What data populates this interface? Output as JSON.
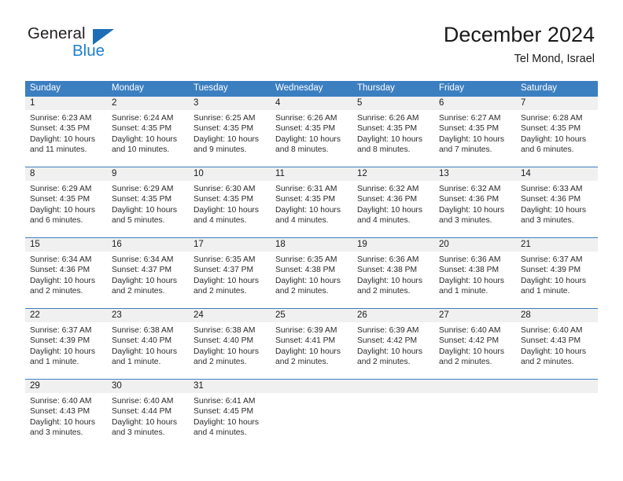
{
  "brand": {
    "name_part1": "General",
    "name_part2": "Blue",
    "triangle_color": "#1f6db4",
    "blue_color": "#1f7fd0"
  },
  "header": {
    "title": "December 2024",
    "subtitle": "Tel Mond, Israel"
  },
  "theme": {
    "header_bg": "#3c7fc1",
    "header_text": "#ffffff",
    "date_band_bg": "#f0f0f0",
    "cell_bg": "#ffffff",
    "divider": "#3c7fc1"
  },
  "weekdays": [
    "Sunday",
    "Monday",
    "Tuesday",
    "Wednesday",
    "Thursday",
    "Friday",
    "Saturday"
  ],
  "weeks": [
    {
      "days": [
        {
          "date": "1",
          "sunrise": "Sunrise: 6:23 AM",
          "sunset": "Sunset: 4:35 PM",
          "daylight_line1": "Daylight: 10 hours",
          "daylight_line2": "and 11 minutes."
        },
        {
          "date": "2",
          "sunrise": "Sunrise: 6:24 AM",
          "sunset": "Sunset: 4:35 PM",
          "daylight_line1": "Daylight: 10 hours",
          "daylight_line2": "and 10 minutes."
        },
        {
          "date": "3",
          "sunrise": "Sunrise: 6:25 AM",
          "sunset": "Sunset: 4:35 PM",
          "daylight_line1": "Daylight: 10 hours",
          "daylight_line2": "and 9 minutes."
        },
        {
          "date": "4",
          "sunrise": "Sunrise: 6:26 AM",
          "sunset": "Sunset: 4:35 PM",
          "daylight_line1": "Daylight: 10 hours",
          "daylight_line2": "and 8 minutes."
        },
        {
          "date": "5",
          "sunrise": "Sunrise: 6:26 AM",
          "sunset": "Sunset: 4:35 PM",
          "daylight_line1": "Daylight: 10 hours",
          "daylight_line2": "and 8 minutes."
        },
        {
          "date": "6",
          "sunrise": "Sunrise: 6:27 AM",
          "sunset": "Sunset: 4:35 PM",
          "daylight_line1": "Daylight: 10 hours",
          "daylight_line2": "and 7 minutes."
        },
        {
          "date": "7",
          "sunrise": "Sunrise: 6:28 AM",
          "sunset": "Sunset: 4:35 PM",
          "daylight_line1": "Daylight: 10 hours",
          "daylight_line2": "and 6 minutes."
        }
      ]
    },
    {
      "days": [
        {
          "date": "8",
          "sunrise": "Sunrise: 6:29 AM",
          "sunset": "Sunset: 4:35 PM",
          "daylight_line1": "Daylight: 10 hours",
          "daylight_line2": "and 6 minutes."
        },
        {
          "date": "9",
          "sunrise": "Sunrise: 6:29 AM",
          "sunset": "Sunset: 4:35 PM",
          "daylight_line1": "Daylight: 10 hours",
          "daylight_line2": "and 5 minutes."
        },
        {
          "date": "10",
          "sunrise": "Sunrise: 6:30 AM",
          "sunset": "Sunset: 4:35 PM",
          "daylight_line1": "Daylight: 10 hours",
          "daylight_line2": "and 4 minutes."
        },
        {
          "date": "11",
          "sunrise": "Sunrise: 6:31 AM",
          "sunset": "Sunset: 4:35 PM",
          "daylight_line1": "Daylight: 10 hours",
          "daylight_line2": "and 4 minutes."
        },
        {
          "date": "12",
          "sunrise": "Sunrise: 6:32 AM",
          "sunset": "Sunset: 4:36 PM",
          "daylight_line1": "Daylight: 10 hours",
          "daylight_line2": "and 4 minutes."
        },
        {
          "date": "13",
          "sunrise": "Sunrise: 6:32 AM",
          "sunset": "Sunset: 4:36 PM",
          "daylight_line1": "Daylight: 10 hours",
          "daylight_line2": "and 3 minutes."
        },
        {
          "date": "14",
          "sunrise": "Sunrise: 6:33 AM",
          "sunset": "Sunset: 4:36 PM",
          "daylight_line1": "Daylight: 10 hours",
          "daylight_line2": "and 3 minutes."
        }
      ]
    },
    {
      "days": [
        {
          "date": "15",
          "sunrise": "Sunrise: 6:34 AM",
          "sunset": "Sunset: 4:36 PM",
          "daylight_line1": "Daylight: 10 hours",
          "daylight_line2": "and 2 minutes."
        },
        {
          "date": "16",
          "sunrise": "Sunrise: 6:34 AM",
          "sunset": "Sunset: 4:37 PM",
          "daylight_line1": "Daylight: 10 hours",
          "daylight_line2": "and 2 minutes."
        },
        {
          "date": "17",
          "sunrise": "Sunrise: 6:35 AM",
          "sunset": "Sunset: 4:37 PM",
          "daylight_line1": "Daylight: 10 hours",
          "daylight_line2": "and 2 minutes."
        },
        {
          "date": "18",
          "sunrise": "Sunrise: 6:35 AM",
          "sunset": "Sunset: 4:38 PM",
          "daylight_line1": "Daylight: 10 hours",
          "daylight_line2": "and 2 minutes."
        },
        {
          "date": "19",
          "sunrise": "Sunrise: 6:36 AM",
          "sunset": "Sunset: 4:38 PM",
          "daylight_line1": "Daylight: 10 hours",
          "daylight_line2": "and 2 minutes."
        },
        {
          "date": "20",
          "sunrise": "Sunrise: 6:36 AM",
          "sunset": "Sunset: 4:38 PM",
          "daylight_line1": "Daylight: 10 hours",
          "daylight_line2": "and 1 minute."
        },
        {
          "date": "21",
          "sunrise": "Sunrise: 6:37 AM",
          "sunset": "Sunset: 4:39 PM",
          "daylight_line1": "Daylight: 10 hours",
          "daylight_line2": "and 1 minute."
        }
      ]
    },
    {
      "days": [
        {
          "date": "22",
          "sunrise": "Sunrise: 6:37 AM",
          "sunset": "Sunset: 4:39 PM",
          "daylight_line1": "Daylight: 10 hours",
          "daylight_line2": "and 1 minute."
        },
        {
          "date": "23",
          "sunrise": "Sunrise: 6:38 AM",
          "sunset": "Sunset: 4:40 PM",
          "daylight_line1": "Daylight: 10 hours",
          "daylight_line2": "and 1 minute."
        },
        {
          "date": "24",
          "sunrise": "Sunrise: 6:38 AM",
          "sunset": "Sunset: 4:40 PM",
          "daylight_line1": "Daylight: 10 hours",
          "daylight_line2": "and 2 minutes."
        },
        {
          "date": "25",
          "sunrise": "Sunrise: 6:39 AM",
          "sunset": "Sunset: 4:41 PM",
          "daylight_line1": "Daylight: 10 hours",
          "daylight_line2": "and 2 minutes."
        },
        {
          "date": "26",
          "sunrise": "Sunrise: 6:39 AM",
          "sunset": "Sunset: 4:42 PM",
          "daylight_line1": "Daylight: 10 hours",
          "daylight_line2": "and 2 minutes."
        },
        {
          "date": "27",
          "sunrise": "Sunrise: 6:40 AM",
          "sunset": "Sunset: 4:42 PM",
          "daylight_line1": "Daylight: 10 hours",
          "daylight_line2": "and 2 minutes."
        },
        {
          "date": "28",
          "sunrise": "Sunrise: 6:40 AM",
          "sunset": "Sunset: 4:43 PM",
          "daylight_line1": "Daylight: 10 hours",
          "daylight_line2": "and 2 minutes."
        }
      ]
    },
    {
      "days": [
        {
          "date": "29",
          "sunrise": "Sunrise: 6:40 AM",
          "sunset": "Sunset: 4:43 PM",
          "daylight_line1": "Daylight: 10 hours",
          "daylight_line2": "and 3 minutes."
        },
        {
          "date": "30",
          "sunrise": "Sunrise: 6:40 AM",
          "sunset": "Sunset: 4:44 PM",
          "daylight_line1": "Daylight: 10 hours",
          "daylight_line2": "and 3 minutes."
        },
        {
          "date": "31",
          "sunrise": "Sunrise: 6:41 AM",
          "sunset": "Sunset: 4:45 PM",
          "daylight_line1": "Daylight: 10 hours",
          "daylight_line2": "and 4 minutes."
        },
        {
          "date": "",
          "sunrise": "",
          "sunset": "",
          "daylight_line1": "",
          "daylight_line2": ""
        },
        {
          "date": "",
          "sunrise": "",
          "sunset": "",
          "daylight_line1": "",
          "daylight_line2": ""
        },
        {
          "date": "",
          "sunrise": "",
          "sunset": "",
          "daylight_line1": "",
          "daylight_line2": ""
        },
        {
          "date": "",
          "sunrise": "",
          "sunset": "",
          "daylight_line1": "",
          "daylight_line2": ""
        }
      ]
    }
  ]
}
